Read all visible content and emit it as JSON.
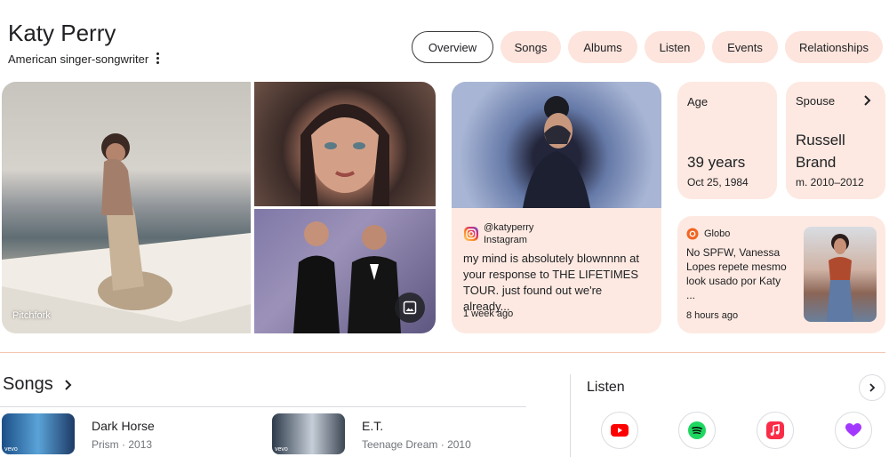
{
  "header": {
    "title": "Katy Perry",
    "subtitle": "American singer-songwriter"
  },
  "tabs": [
    {
      "label": "Overview",
      "active": true
    },
    {
      "label": "Songs"
    },
    {
      "label": "Albums"
    },
    {
      "label": "Listen"
    },
    {
      "label": "Events"
    },
    {
      "label": "Relationships"
    }
  ],
  "images": {
    "source_label": "Pitchfork",
    "view_icon": "image-icon"
  },
  "instagram_post": {
    "handle": "@katyperry",
    "platform": "Instagram",
    "text": "my mind is absolutely blownnnn at your response to THE LIFETIMES TOUR. just found out we're already...",
    "time": "1 week ago"
  },
  "age": {
    "label": "Age",
    "value": "39 years",
    "birth_date": "Oct 25, 1984"
  },
  "spouse": {
    "label": "Spouse",
    "name_line1": "Russell",
    "name_line2": "Brand",
    "married": "m. 2010–2012"
  },
  "news": {
    "source": "Globo",
    "text": "No SPFW, Vanessa Lopes repete mesmo look usado por Katy",
    "ellipsis": "...",
    "time": "8 hours ago"
  },
  "songs": {
    "heading": "Songs",
    "items": [
      {
        "title": "Dark Horse",
        "album": "Prism",
        "year": "2013"
      },
      {
        "title": "E.T.",
        "album": "Teenage Dream",
        "year": "2010"
      }
    ],
    "vevo": "vevo"
  },
  "listen": {
    "heading": "Listen",
    "services": [
      "youtube-icon",
      "spotify-icon",
      "apple-music-icon",
      "deezer-icon"
    ]
  },
  "colors": {
    "card_bg": "#fde9e1",
    "tab_bg": "#fde4dc",
    "divider": "#f4c7b5",
    "youtube": "#ff0000",
    "spotify": "#1ed760",
    "apple_music": "#fa2d48",
    "deezer": "#a238ff",
    "globo": "#f26522"
  }
}
